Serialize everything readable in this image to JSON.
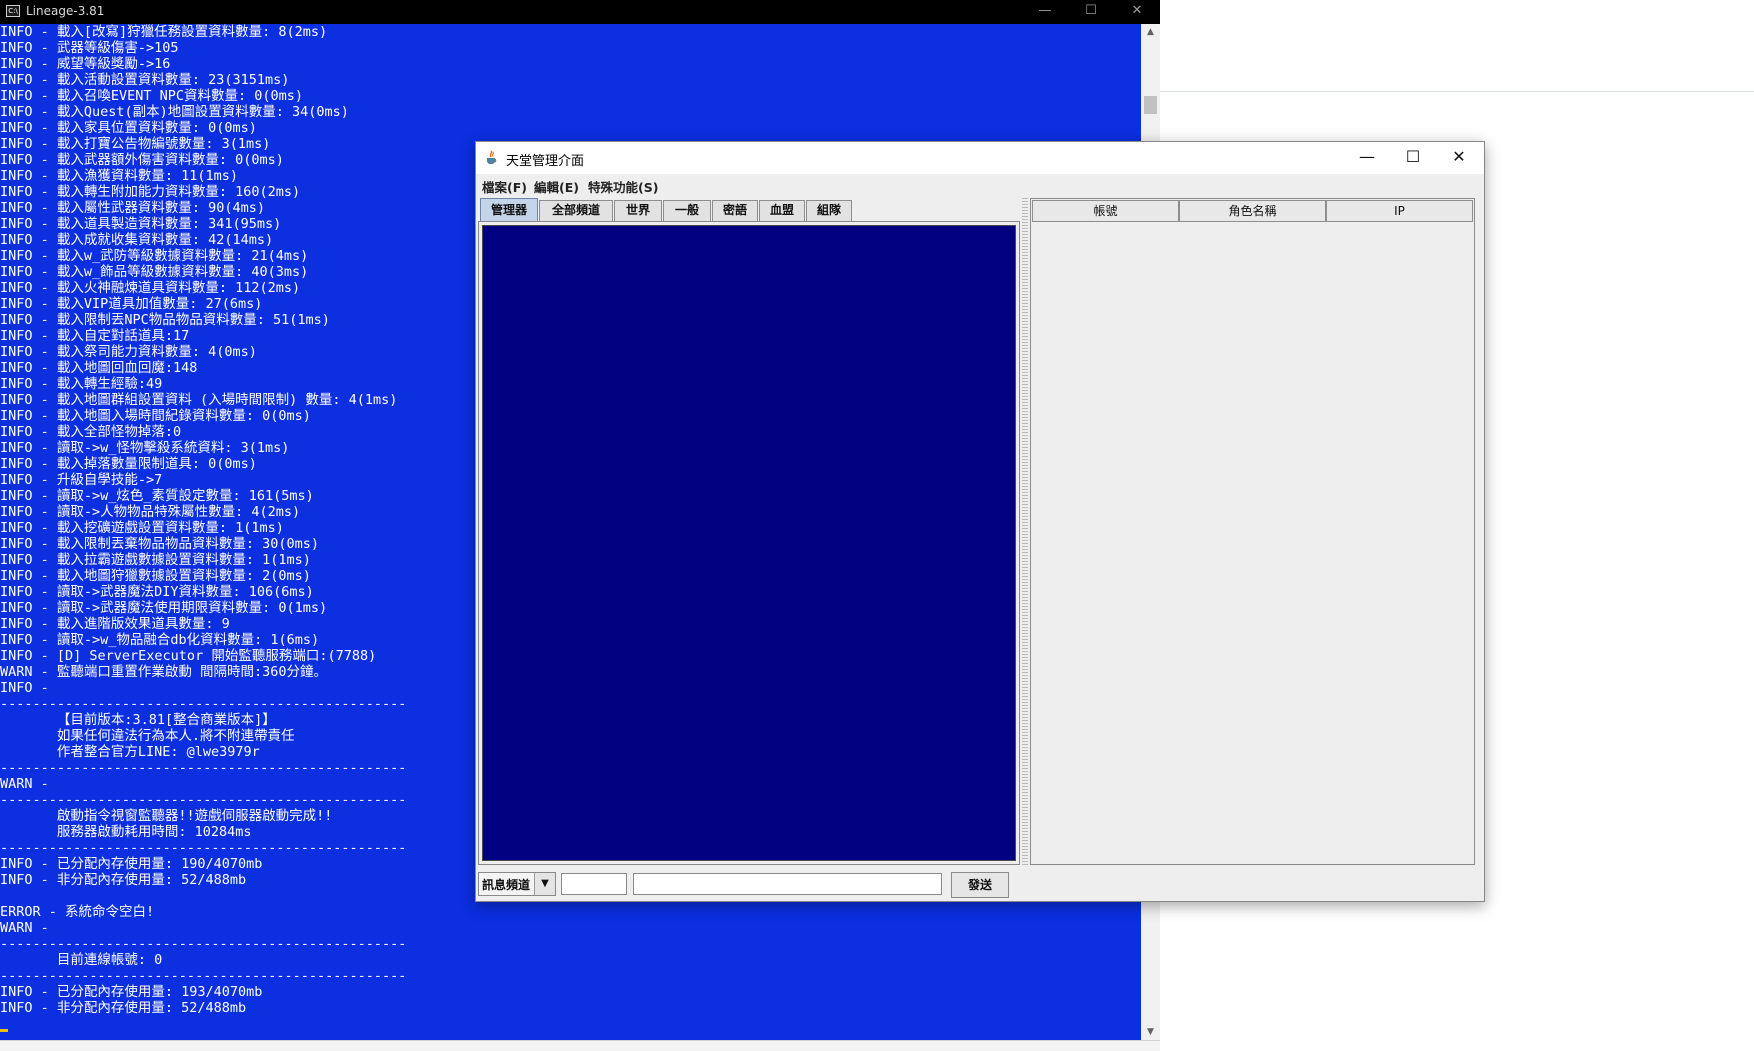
{
  "console": {
    "title": "Lineage-3.81",
    "icon": "console-app-icon",
    "icon_text": "C:\\",
    "text_color": "#ffffff",
    "background": "#0c2fe0",
    "lines": [
      "INFO - 載入[改寫]狩獵任務設置資料數量: 8(2ms)",
      "INFO - 武器等級傷害->105",
      "INFO - 威望等級獎勵->16",
      "INFO - 載入活動設置資料數量: 23(3151ms)",
      "INFO - 載入召喚EVENT NPC資料數量: 0(0ms)",
      "INFO - 載入Quest(副本)地圖設置資料數量: 34(0ms)",
      "INFO - 載入家具位置資料數量: 0(0ms)",
      "INFO - 載入打寶公告物編號數量: 3(1ms)",
      "INFO - 載入武器額外傷害資料數量: 0(0ms)",
      "INFO - 載入漁獲資料數量: 11(1ms)",
      "INFO - 載入轉生附加能力資料數量: 160(2ms)",
      "INFO - 載入屬性武器資料數量: 90(4ms)",
      "INFO - 載入道具製造資料數量: 341(95ms)",
      "INFO - 載入成就收集資料數量: 42(14ms)",
      "INFO - 載入w_武防等級數據資料數量: 21(4ms)",
      "INFO - 載入w_飾品等級數據資料數量: 40(3ms)",
      "INFO - 載入火神融煉道具資料數量: 112(2ms)",
      "INFO - 載入VIP道具加值數量: 27(6ms)",
      "INFO - 載入限制丟NPC物品物品資料數量: 51(1ms)",
      "INFO - 載入自定對話道具:17",
      "INFO - 載入祭司能力資料數量: 4(0ms)",
      "INFO - 載入地圖回血回魔:148",
      "INFO - 載入轉生經驗:49",
      "INFO - 載入地圖群組設置資料 (入場時間限制) 數量: 4(1ms)",
      "INFO - 載入地圖入場時間紀錄資料數量: 0(0ms)",
      "INFO - 載入全部怪物掉落:0",
      "INFO - 讀取->w_怪物擊殺系統資料: 3(1ms)",
      "INFO - 載入掉落數量限制道具: 0(0ms)",
      "INFO - 升級自學技能->7",
      "INFO - 讀取->w_炫色_素質設定數量: 161(5ms)",
      "INFO - 讀取->人物物品特殊屬性數量: 4(2ms)",
      "INFO - 載入挖礦遊戲設置資料數量: 1(1ms)",
      "INFO - 載入限制丟棄物品物品資料數量: 30(0ms)",
      "INFO - 載入拉霸遊戲數據設置資料數量: 1(1ms)",
      "INFO - 載入地圖狩獵數據設置資料數量: 2(0ms)",
      "INFO - 讀取->武器魔法DIY資料數量: 106(6ms)",
      "INFO - 讀取->武器魔法使用期限資料數量: 0(1ms)",
      "INFO - 載入進階版效果道具數量: 9",
      "INFO - 讀取->w_物品融合db化資料數量: 1(6ms)",
      "INFO - [D] ServerExecutor 開始監聽服務端口:(7788)",
      "WARN - 監聽端口重置作業啟動 間隔時間:360分鐘。",
      "INFO -",
      "--------------------------------------------------",
      "       【目前版本:3.81[整合商業版本]】",
      "       如果任何違法行為本人.將不附連帶責任",
      "       作者整合官方LINE: @lwe3979r",
      "--------------------------------------------------",
      "WARN -",
      "--------------------------------------------------",
      "       啟動指令視窗監聽器!!遊戲伺服器啟動完成!!",
      "       服務器啟動耗用時間: 10284ms",
      "--------------------------------------------------",
      "INFO - 已分配內存使用量: 190/4070mb",
      "INFO - 非分配內存使用量: 52/488mb",
      "",
      "ERROR - 系統命令空白!",
      "WARN -",
      "--------------------------------------------------",
      "       目前連線帳號: 0",
      "--------------------------------------------------",
      "INFO - 已分配內存使用量: 193/4070mb",
      "INFO - 非分配內存使用量: 52/488mb"
    ],
    "window_controls": [
      "minimize-icon",
      "maximize-icon",
      "close-icon"
    ]
  },
  "admin": {
    "title": "天堂管理介面",
    "icon": "java-cup-icon",
    "menus": [
      "檔案(F)",
      "編輯(E)",
      "特殊功能(S)"
    ],
    "tabs": [
      "管理器",
      "全部頻道",
      "世界",
      "一般",
      "密語",
      "血盟",
      "組隊"
    ],
    "active_tab": "管理器",
    "message_area_color": "#000080",
    "table_columns": [
      "帳號",
      "角色名稱",
      "IP"
    ],
    "channel_select_value": "訊息頻道",
    "target_input_value": "",
    "message_input_value": "",
    "send_label": "發送",
    "window_controls": [
      "minimize-icon",
      "maximize-icon",
      "close-icon"
    ]
  }
}
